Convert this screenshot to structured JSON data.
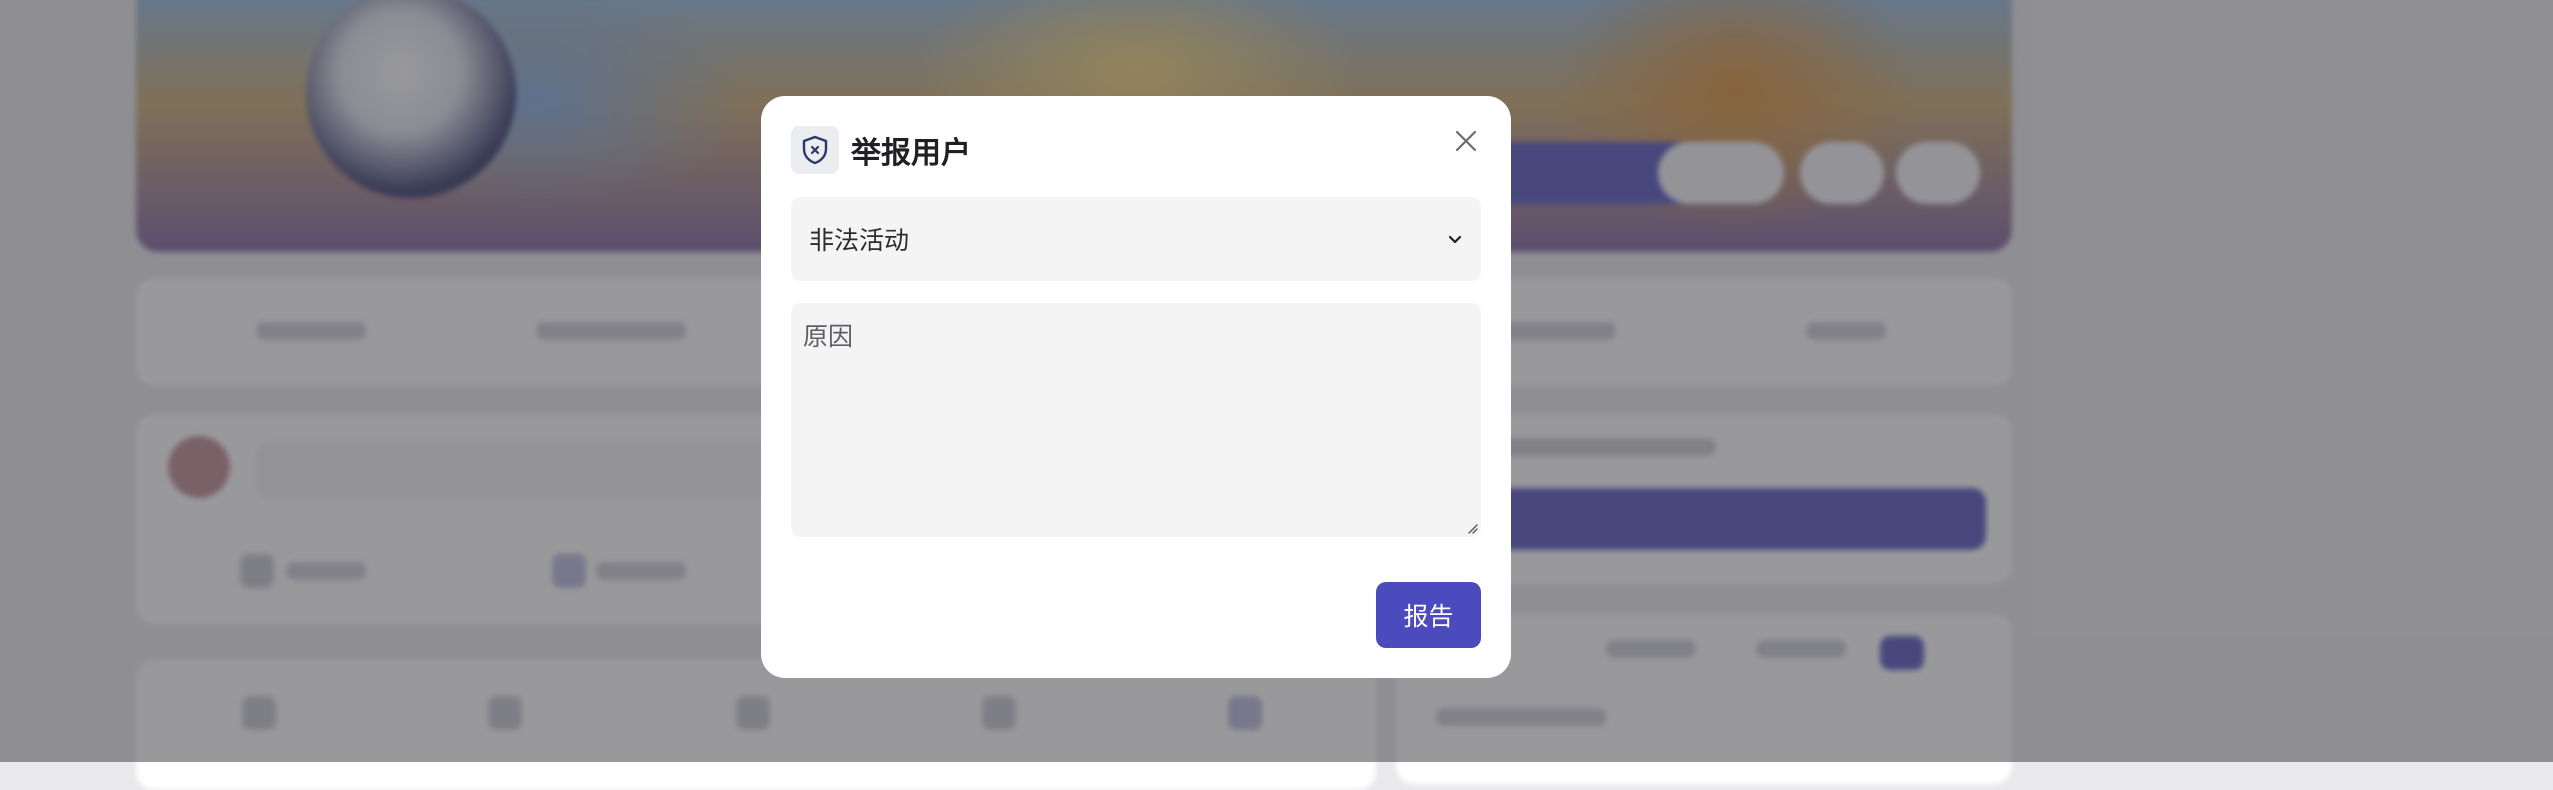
{
  "modal": {
    "title": "举报用户",
    "header_icon": "shield-x-icon",
    "close_icon": "close-icon",
    "reason_select": {
      "selected": "非法活动",
      "icon": "chevron-down-icon"
    },
    "reason_textarea": {
      "placeholder": "原因",
      "value": ""
    },
    "submit_label": "报告"
  },
  "colors": {
    "accent": "#4b4bbd",
    "overlay": "#46464b",
    "input_bg": "#f4f4f4"
  }
}
